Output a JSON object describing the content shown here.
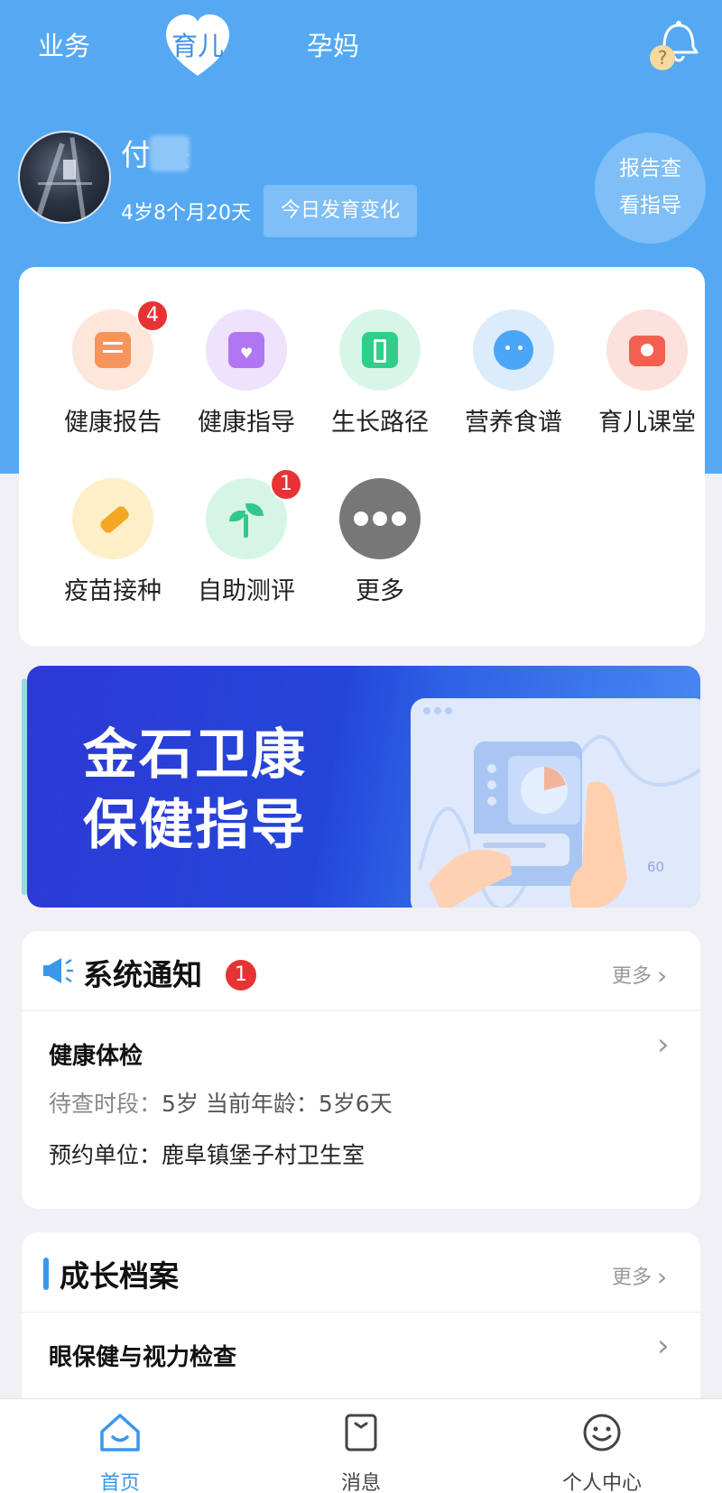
{
  "top_tabs": {
    "business": "业务",
    "childcare": "育儿",
    "pregnancy": "孕妈"
  },
  "child": {
    "name": "付  熹",
    "age": "4岁8个月20天",
    "daily_button": "今日发育变化",
    "report_button_line1": "报告查",
    "report_button_line2": "看指导"
  },
  "services": [
    {
      "label": "健康报告",
      "badge": "4",
      "icon": "report-icon",
      "color": "#f7945c"
    },
    {
      "label": "健康指导",
      "badge": "",
      "icon": "heart-book-icon",
      "color": "#b176f2"
    },
    {
      "label": "生长路径",
      "badge": "",
      "icon": "door-person-icon",
      "color": "#2fcf8a"
    },
    {
      "label": "营养食谱",
      "badge": "",
      "icon": "face-icon",
      "color": "#4aa6f7"
    },
    {
      "label": "育儿课堂",
      "badge": "",
      "icon": "camera-icon",
      "color": "#f4604f"
    },
    {
      "label": "疫苗接种",
      "badge": "",
      "icon": "syringe-icon",
      "color": "#f5a623"
    },
    {
      "label": "自助测评",
      "badge": "1",
      "icon": "sprout-icon",
      "color": "#31c98b"
    },
    {
      "label": "更多",
      "badge": "",
      "icon": "more-dots-icon",
      "color": "#777777"
    }
  ],
  "banner": {
    "line1": "金石卫康",
    "line2": "保健指导",
    "axis_tick": "60"
  },
  "notice": {
    "title": "系统通知",
    "badge": "1",
    "more": "更多",
    "item_title": "健康体检",
    "period_label": "待查时段：",
    "period_value": "5岁",
    "age_label": "当前年龄：",
    "age_value": "5岁6天",
    "unit_label": "预约单位：",
    "unit_value": "鹿阜镇堡子村卫生室"
  },
  "growth": {
    "title": "成长档案",
    "more": "更多",
    "item_title": "眼保健与视力检查"
  },
  "bottom_nav": {
    "home": "首页",
    "messages": "消息",
    "profile": "个人中心"
  },
  "colors": {
    "primary": "#55a9f3",
    "active_nav": "#3b97ea",
    "badge": "#e73333"
  }
}
